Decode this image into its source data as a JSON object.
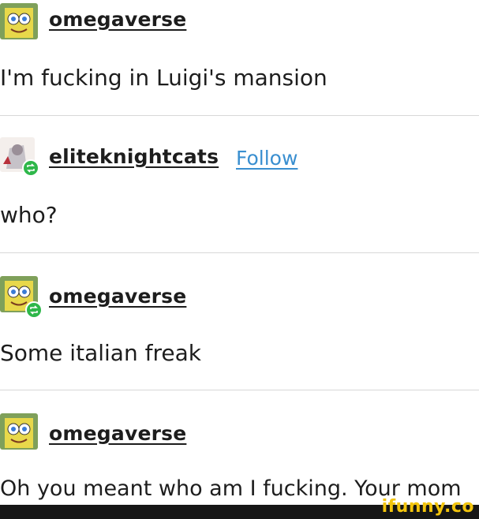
{
  "posts": [
    {
      "username": "omegaverse",
      "text": "I'm fucking in Luigi's mansion",
      "avatar": "spongebob-icon",
      "reblog": false
    },
    {
      "username": "eliteknightcats",
      "follow_label": "Follow",
      "text": "who?",
      "avatar": "knight-cat-icon",
      "reblog": true
    },
    {
      "username": "omegaverse",
      "text": "Some italian freak",
      "avatar": "spongebob-icon",
      "reblog": true
    },
    {
      "username": "omegaverse",
      "text": "Oh you meant who am I fucking. Your mom",
      "avatar": "spongebob-icon",
      "reblog": false
    }
  ],
  "watermark": "ifunny.co",
  "colors": {
    "follow": "#3a8fd0",
    "reblog_badge": "#2eb74a",
    "watermark": "#f2c40c",
    "divider": "#d8d8d8"
  }
}
